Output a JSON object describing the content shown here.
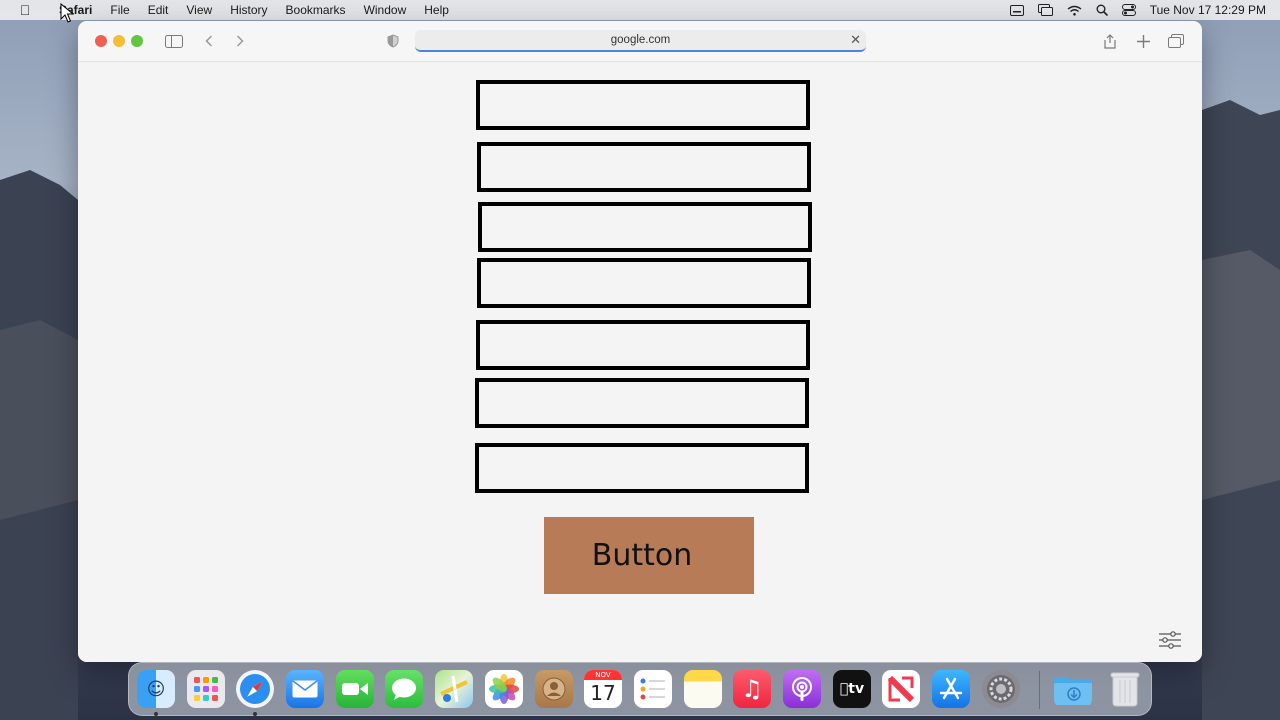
{
  "menubar": {
    "app_name": "Safari",
    "menus": [
      "File",
      "Edit",
      "View",
      "History",
      "Bookmarks",
      "Window",
      "Help"
    ],
    "clock": "Tue Nov 17  12:29 PM"
  },
  "browser": {
    "address": "google.com"
  },
  "form": {
    "fields": [
      {
        "value": "",
        "placeholder": ""
      },
      {
        "value": "",
        "placeholder": ""
      },
      {
        "value": "",
        "placeholder": ""
      },
      {
        "value": "",
        "placeholder": ""
      },
      {
        "value": "",
        "placeholder": ""
      },
      {
        "value": "",
        "placeholder": ""
      },
      {
        "value": "",
        "placeholder": ""
      }
    ],
    "button_label": "Button",
    "button_color": "#b87b58"
  },
  "dock": {
    "apps": [
      "finder-icon",
      "launchpad-icon",
      "safari-icon",
      "mail-icon",
      "facetime-icon",
      "messages-icon",
      "maps-icon",
      "photos-icon",
      "contacts-icon",
      "calendar-icon",
      "reminders-icon",
      "notes-icon",
      "music-icon",
      "podcasts-icon",
      "tv-icon",
      "news-icon",
      "app-store-icon",
      "system-preferences-icon",
      "downloads-icon",
      "trash-icon"
    ],
    "calendar_month": "NOV",
    "calendar_day": "17",
    "tv_label": "tv"
  }
}
